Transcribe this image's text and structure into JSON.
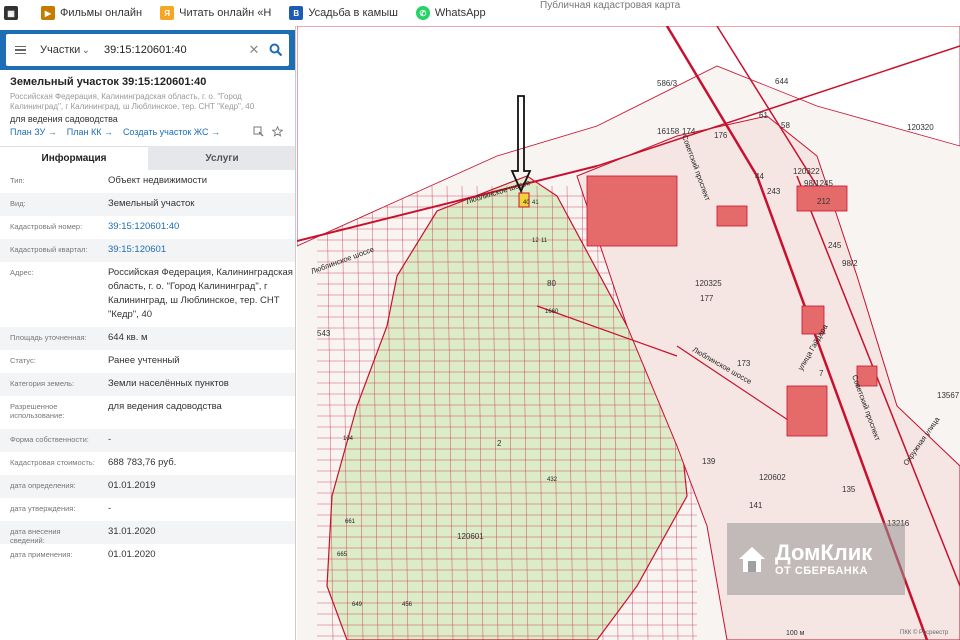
{
  "bookmarks": [
    {
      "label": "",
      "icon": "box-icon",
      "color": "#333"
    },
    {
      "label": "Фильмы онлайн",
      "icon": "film-icon",
      "color": "#c47c00"
    },
    {
      "label": "Читать онлайн «Н",
      "icon": "book-icon",
      "color": "#f5a623"
    },
    {
      "label": "Усадьба в камыш",
      "icon": "b-icon",
      "color": "#1e5bb5"
    },
    {
      "label": "WhatsApp",
      "icon": "whatsapp-icon",
      "color": "#25d366"
    }
  ],
  "bookmark_right": "Публичная кадастровая карта",
  "search": {
    "category": "Участки",
    "query": "39:15:120601:40"
  },
  "object": {
    "title": "Земельный участок 39:15:120601:40",
    "address": "Российская Федерация, Калининградская область, г. о. \"Город Калининград\", г Калининград, ш Люблинское, тер. СНТ \"Кедр\", 40",
    "usage": "для ведения садоводства",
    "links": [
      "План ЗУ →",
      "План КК →",
      "Создать участок ЖС →"
    ]
  },
  "tabs": [
    "Информация",
    "Услуги"
  ],
  "info_rows": [
    {
      "label": "Тип:",
      "value": "Объект недвижимости"
    },
    {
      "label": "Вид:",
      "value": "Земельный участок"
    },
    {
      "label": "Кадастровый номер:",
      "value": "39:15:120601:40"
    },
    {
      "label": "Кадастровый квартал:",
      "value": "39:15:120601"
    },
    {
      "label": "Адрес:",
      "value": "Российская Федерация, Калининградская область, г. о. \"Город Калининград\", г Калининград, ш Люблинское, тер. СНТ \"Кедр\", 40"
    },
    {
      "label": "Площадь уточненная:",
      "value": "644 кв. м"
    },
    {
      "label": "Статус:",
      "value": "Ранее учтенный"
    },
    {
      "label": "Категория земель:",
      "value": "Земли населённых пунктов"
    },
    {
      "label": "Разрешенное использование:",
      "value": "для ведения садоводства"
    },
    {
      "label": "Форма собственности:",
      "value": "-"
    },
    {
      "label": "Кадастровая стоимость:",
      "value": "688 783,76 руб."
    },
    {
      "label": "дата определения:",
      "value": "01.01.2019"
    },
    {
      "label": "дата утверждения:",
      "value": "-"
    },
    {
      "label": "дата внесения сведений:",
      "value": "31.01.2020"
    },
    {
      "label": "дата применения:",
      "value": "01.01.2020"
    }
  ],
  "map": {
    "streets": [
      "Советский проспект",
      "Люблинское шоссе",
      "Люблинское шоссе",
      "улица Гайдара",
      "Советский проспект",
      "Люблинское шоссе",
      "Окружная улица"
    ],
    "labels": [
      "586/3",
      "644",
      "120320",
      "16158",
      "120322",
      "98/1245",
      "212",
      "120325",
      "177",
      "173",
      "543",
      "13567",
      "139",
      "120602",
      "135",
      "141",
      "13216",
      "120601",
      "61",
      "58",
      "174",
      "176",
      "44",
      "243",
      "245",
      "98/2",
      "7",
      "2",
      "80"
    ],
    "parcel_numbers": [
      "40",
      "41",
      "12",
      "11",
      "104",
      "432",
      "661",
      "665",
      "649",
      "456",
      "1660"
    ],
    "watermark_brand": "ДомКлик",
    "watermark_sub": "ОТ СБЕРБАНКА",
    "scale": "100 м",
    "footer": "ПКК © Росреестр"
  },
  "colors": {
    "accent": "#1e6eb5",
    "parcel_fill": "#f6e6e3",
    "parcel_line": "#c8102e",
    "green_area": "#dcebc8",
    "building": "#e56a6a",
    "selected": "#f4d33a"
  }
}
